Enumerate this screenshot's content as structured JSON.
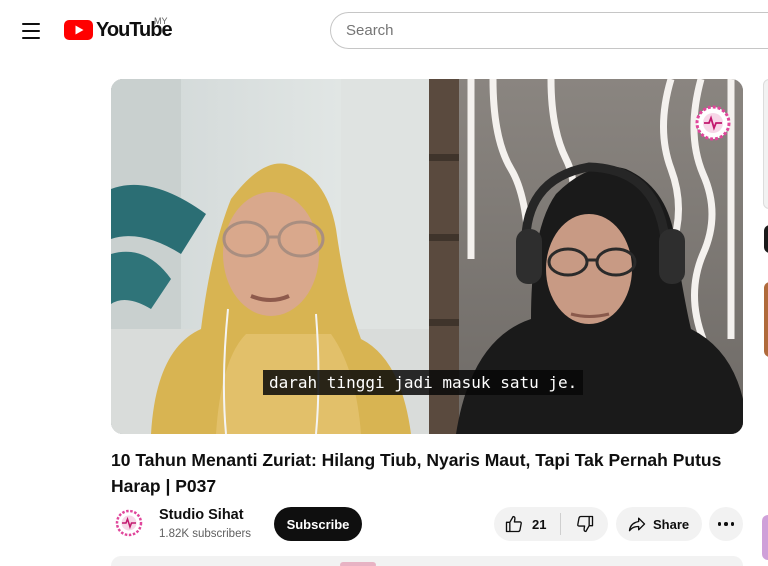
{
  "header": {
    "logo_text": "YouTube",
    "country_code": "MY",
    "search_placeholder": "Search",
    "icons": [
      "menu-icon",
      "youtube-logo-icon"
    ]
  },
  "player": {
    "caption": "darah tinggi jadi masuk satu je."
  },
  "video": {
    "title": "10 Tahun Menanti Zuriat: Hilang Tiub, Nyaris Maut, Tapi Tak Pernah Putus Harap | P037"
  },
  "channel": {
    "name": "Studio Sihat",
    "subscribers": "1.82K subscribers",
    "subscribe_label": "Subscribe"
  },
  "actions": {
    "like_count": "21",
    "share_label": "Share",
    "icons": [
      "thumbs-up-icon",
      "thumbs-down-icon",
      "share-icon",
      "more-icon"
    ]
  },
  "colors": {
    "brand_red": "#ff0000",
    "text_primary": "#0f0f0f",
    "text_secondary": "#606060",
    "button_bg": "#f2f2f2"
  }
}
